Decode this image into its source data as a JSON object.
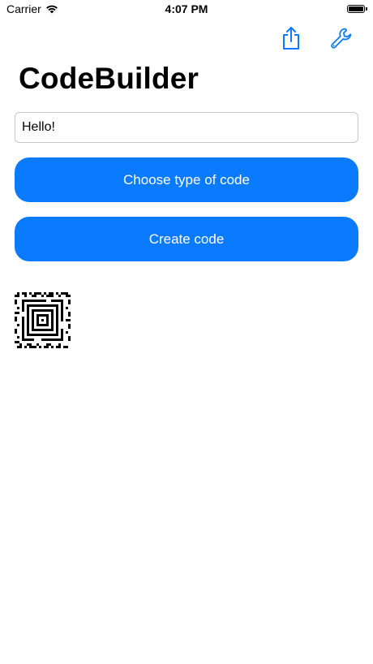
{
  "status_bar": {
    "carrier": "Carrier",
    "time": "4:07 PM",
    "wifi_icon": "wifi-icon",
    "battery_level": 1.0
  },
  "nav": {
    "share_icon": "share-icon",
    "settings_icon": "wrench-icon",
    "accent_color": "#0a7aff"
  },
  "app": {
    "title": "CodeBuilder"
  },
  "input": {
    "value": "Hello!"
  },
  "buttons": {
    "choose_type": "Choose type of code",
    "create": "Create code",
    "color": "#0a7aff"
  },
  "generated_code": {
    "type": "aztec-code-icon"
  }
}
